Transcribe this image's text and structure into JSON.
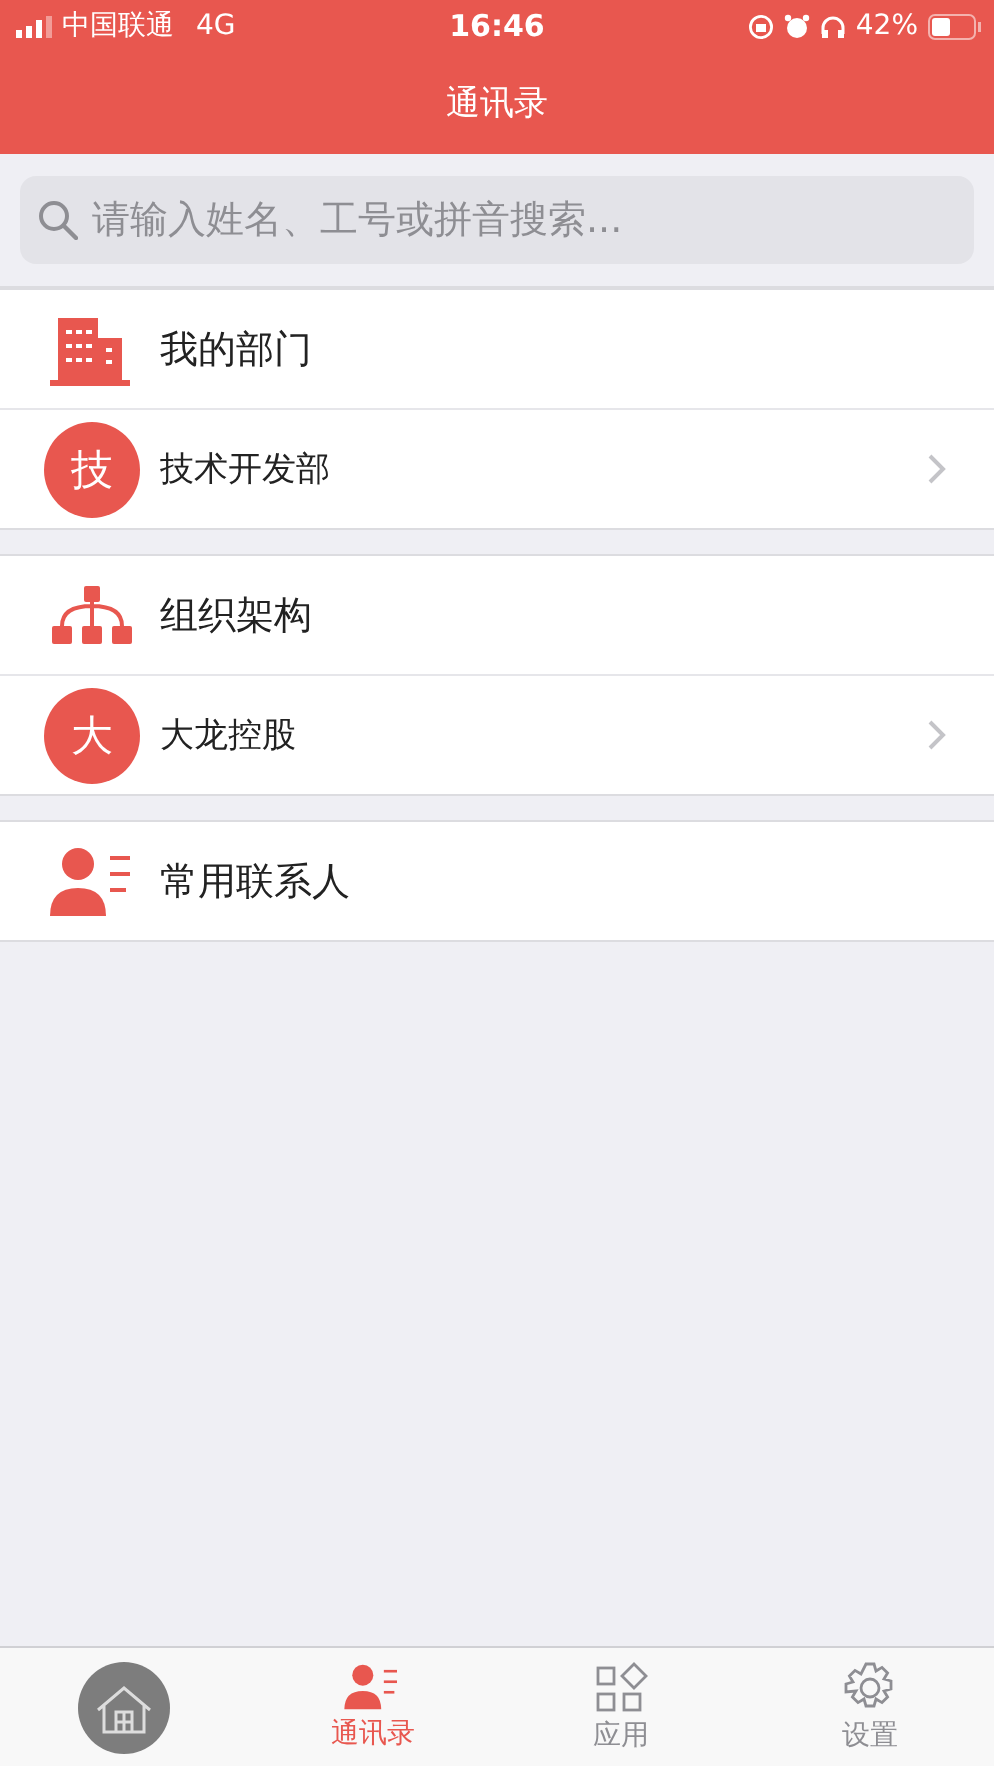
{
  "status_bar": {
    "carrier": "中国联通",
    "network": "4G",
    "time": "16:46",
    "battery": "42%"
  },
  "nav": {
    "title": "通讯录"
  },
  "search": {
    "placeholder": "请输入姓名、工号或拼音搜索..."
  },
  "groups": [
    {
      "kind": "building",
      "label": "我的部门",
      "items": [
        {
          "avatar": "技",
          "label": "技术开发部"
        }
      ]
    },
    {
      "kind": "org",
      "label": "组织架构",
      "items": [
        {
          "avatar": "大",
          "label": "大龙控股"
        }
      ]
    },
    {
      "kind": "contacts",
      "label": "常用联系人"
    }
  ],
  "tabs": [
    {
      "kind": "home",
      "selected": false
    },
    {
      "kind": "contacts",
      "label": "通讯录",
      "selected": true
    },
    {
      "kind": "apps",
      "label": "应用",
      "selected": false
    },
    {
      "kind": "settings",
      "label": "设置",
      "selected": false
    }
  ]
}
